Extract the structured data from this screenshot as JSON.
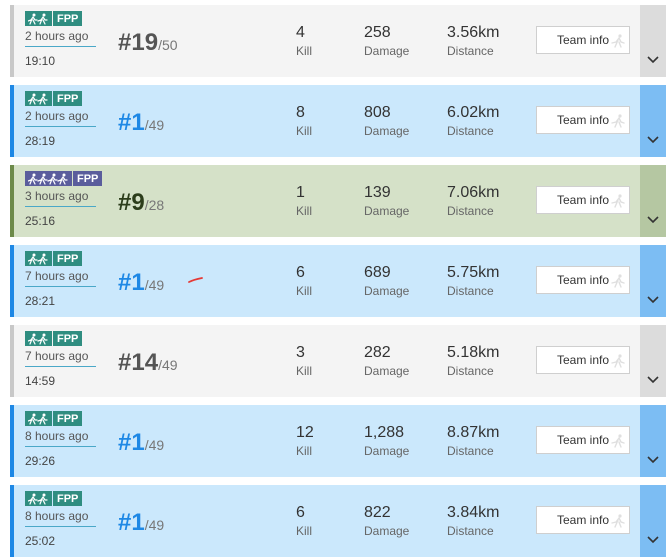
{
  "matches": [
    {
      "style": "lose",
      "mode_tag": "FPP",
      "mode_icon": "duo-runners-icon",
      "time_ago": "2 hours ago",
      "duration": "19:10",
      "rank": "19",
      "total": "/50",
      "kills": "4",
      "damage": "258",
      "distance": "3.56km",
      "team_label": "Team info"
    },
    {
      "style": "win",
      "mode_tag": "FPP",
      "mode_icon": "duo-runners-icon",
      "time_ago": "2 hours ago",
      "duration": "28:19",
      "rank": "1",
      "total": "/49",
      "kills": "8",
      "damage": "808",
      "distance": "6.02km",
      "team_label": "Team info"
    },
    {
      "style": "top10",
      "mode_tag": "FPP",
      "mode_icon": "squad-runners-icon",
      "time_ago": "3 hours ago",
      "duration": "25:16",
      "rank": "9",
      "total": "/28",
      "kills": "1",
      "damage": "139",
      "distance": "7.06km",
      "team_label": "Team info"
    },
    {
      "style": "win",
      "mode_tag": "FPP",
      "mode_icon": "duo-runners-icon",
      "time_ago": "7 hours ago",
      "duration": "28:21",
      "rank": "1",
      "total": "/49",
      "kills": "6",
      "damage": "689",
      "distance": "5.75km",
      "team_label": "Team info"
    },
    {
      "style": "lose",
      "mode_tag": "FPP",
      "mode_icon": "duo-runners-icon",
      "time_ago": "7 hours ago",
      "duration": "14:59",
      "rank": "14",
      "total": "/49",
      "kills": "3",
      "damage": "282",
      "distance": "5.18km",
      "team_label": "Team info"
    },
    {
      "style": "win",
      "mode_tag": "FPP",
      "mode_icon": "duo-runners-icon",
      "time_ago": "8 hours ago",
      "duration": "29:26",
      "rank": "1",
      "total": "/49",
      "kills": "12",
      "damage": "1,288",
      "distance": "8.87km",
      "team_label": "Team info"
    },
    {
      "style": "win",
      "mode_tag": "FPP",
      "mode_icon": "duo-runners-icon",
      "time_ago": "8 hours ago",
      "duration": "25:02",
      "rank": "1",
      "total": "/49",
      "kills": "6",
      "damage": "822",
      "distance": "3.84km",
      "team_label": "Team info"
    }
  ],
  "labels": {
    "hash": "#",
    "kill": "Kill",
    "damage": "Damage",
    "distance": "Distance"
  },
  "colors": {
    "win_bg": "#cbe8fc",
    "win_accent": "#1e88e5",
    "top10_bg": "#d5e1c8",
    "lose_bg": "#f4f4f4",
    "mode_teal": "#2f8d80",
    "mode_purple": "#5a5d9c",
    "annotation_red": "#e53935"
  },
  "icons": {
    "expand": "chevron-down-icon",
    "button_decoration": "runner-silhouette-icon",
    "annotation": "red-pen-stroke"
  }
}
